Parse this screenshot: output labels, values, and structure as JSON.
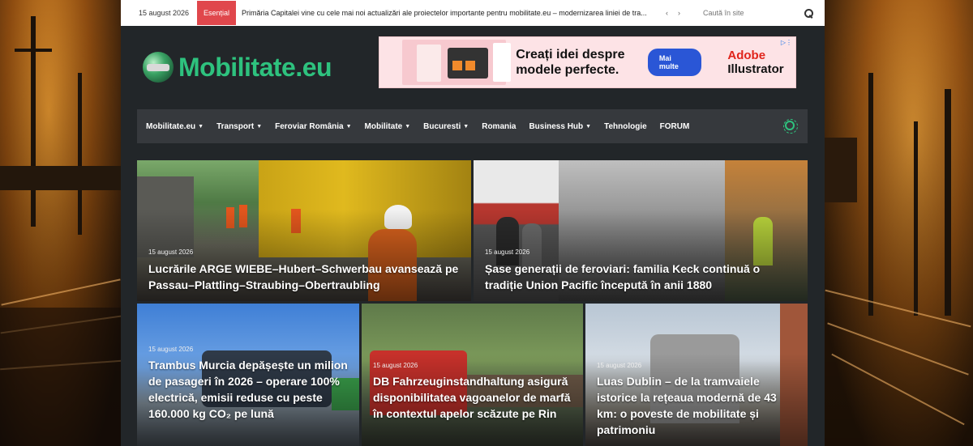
{
  "topbar": {
    "date": "15 august 2026",
    "badge": "Esențial",
    "ticker": "Primăria Capitalei vine cu cele mai noi actualizări ale proiectelor importante pentru mobilitate.eu – modernizarea liniei de tra...",
    "search_placeholder": "Caută în site"
  },
  "header": {
    "logo_text": "Mobilitate.eu",
    "ad": {
      "headline": "Creați idei despre modele perfecte.",
      "button": "Mai multe",
      "brand_line1": "Adobe",
      "brand_line2": "Illustrator"
    }
  },
  "nav": {
    "items": [
      {
        "label": "Mobilitate.eu",
        "chevron": true
      },
      {
        "label": "Transport",
        "chevron": true
      },
      {
        "label": "Feroviar România",
        "chevron": true
      },
      {
        "label": "Mobilitate",
        "chevron": true
      },
      {
        "label": "Bucuresti",
        "chevron": true
      },
      {
        "label": "Romania",
        "chevron": false
      },
      {
        "label": "Business Hub",
        "chevron": true
      },
      {
        "label": "Tehnologie",
        "chevron": false
      },
      {
        "label": "FORUM",
        "chevron": false
      }
    ]
  },
  "articles": [
    {
      "date": "15 august 2026",
      "title": "Lucrările ARGE WIEBE–Hubert–Schwerbau avansează pe Passau–Plattling–Straubing–Obertraubling"
    },
    {
      "date": "15 august 2026",
      "title": "Șase generații de feroviari: familia Keck continuă o tradiție Union Pacific începută în anii 1880"
    },
    {
      "date": "15 august 2026",
      "title": "Trambus Murcia depășește un milion de pasageri în 2026 – operare 100% electrică, emisii reduse cu peste 160.000 kg CO₂ pe lună"
    },
    {
      "date": "15 august 2026",
      "title": "DB Fahrzeuginstandhaltung asigură disponibilitatea vagoanelor de marfă în contextul apelor scăzute pe Rin"
    },
    {
      "date": "15 august 2026",
      "title": "Luas Dublin – de la tramvaiele istorice la rețeaua modernă de 43 km: o poveste de mobilitate și patrimoniu"
    }
  ]
}
